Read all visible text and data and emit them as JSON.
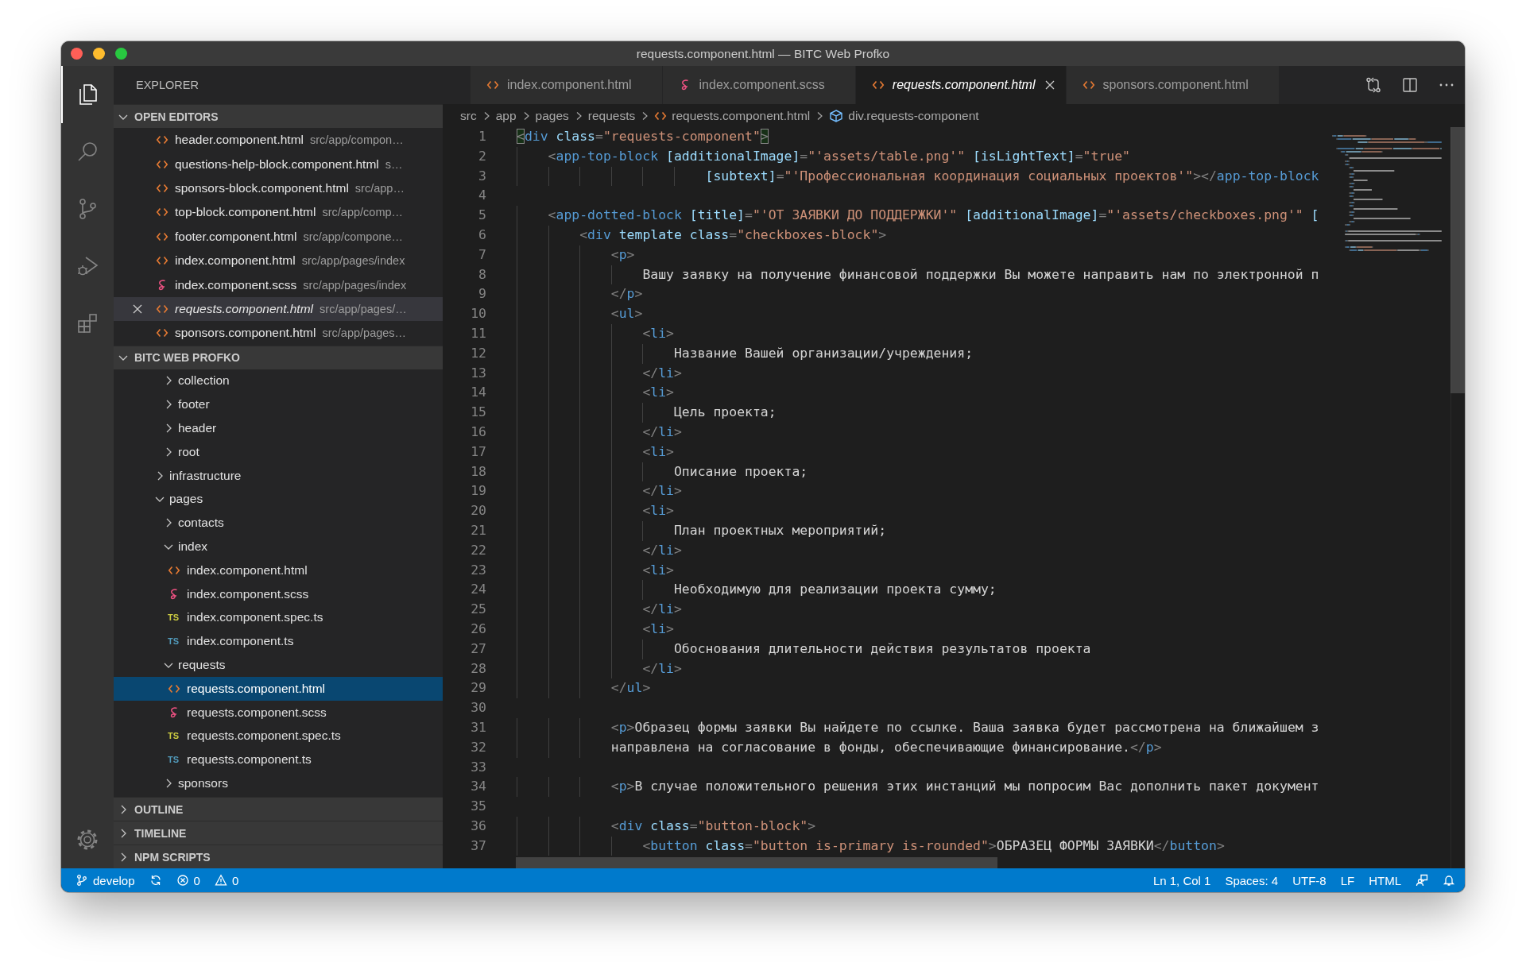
{
  "window": {
    "title": "requests.component.html — BITC Web Profko"
  },
  "activity_bar": {
    "items": [
      {
        "kind": "explorer",
        "selected": true
      },
      {
        "kind": "search",
        "selected": false
      },
      {
        "kind": "source-control",
        "selected": false
      },
      {
        "kind": "run-debug",
        "selected": false
      },
      {
        "kind": "extensions",
        "selected": false
      }
    ],
    "bottom": [
      {
        "kind": "settings"
      }
    ]
  },
  "sidebar": {
    "title": "EXPLORER",
    "sections": [
      {
        "kind": "open-editors",
        "title": "OPEN EDITORS",
        "expanded": true,
        "items": [
          {
            "kind": "html",
            "name": "header.component.html",
            "path": "src/app/compon…",
            "selected": false,
            "preview": false
          },
          {
            "kind": "html",
            "name": "questions-help-block.component.html",
            "path": "s…",
            "selected": false,
            "preview": false
          },
          {
            "kind": "html",
            "name": "sponsors-block.component.html",
            "path": "src/app…",
            "selected": false,
            "preview": false
          },
          {
            "kind": "html",
            "name": "top-block.component.html",
            "path": "src/app/comp…",
            "selected": false,
            "preview": false
          },
          {
            "kind": "html",
            "name": "footer.component.html",
            "path": "src/app/compone…",
            "selected": false,
            "preview": false
          },
          {
            "kind": "html",
            "name": "index.component.html",
            "path": "src/app/pages/index",
            "selected": false,
            "preview": false
          },
          {
            "kind": "scss",
            "name": "index.component.scss",
            "path": "src/app/pages/index",
            "selected": false,
            "preview": false
          },
          {
            "kind": "html",
            "name": "requests.component.html",
            "path": "src/app/pages/…",
            "selected": true,
            "preview": true
          },
          {
            "kind": "html",
            "name": "sponsors.component.html",
            "path": "src/app/pages…",
            "selected": false,
            "preview": false
          }
        ]
      },
      {
        "kind": "tree",
        "title": "BITC WEB PROFKO",
        "expanded": true,
        "tree": [
          {
            "children": [
              {
                "kind": "folder",
                "name": "collection",
                "expanded": false,
                "selected": false
              },
              {
                "kind": "folder",
                "name": "footer",
                "expanded": false,
                "selected": false
              },
              {
                "kind": "folder",
                "name": "header",
                "expanded": false,
                "selected": false
              },
              {
                "kind": "folder",
                "name": "root",
                "expanded": false,
                "selected": false
              }
            ]
          },
          {
            "kind": "folder",
            "name": "infrastructure",
            "expanded": false,
            "selected": false
          },
          {
            "kind": "folder",
            "name": "pages",
            "expanded": true,
            "selected": false,
            "children": [
              {
                "kind": "folder",
                "name": "contacts",
                "expanded": false,
                "selected": false
              },
              {
                "kind": "folder",
                "name": "index",
                "expanded": true,
                "selected": false,
                "children": [
                  {
                    "kind": "html",
                    "name": "index.component.html",
                    "selected": false
                  },
                  {
                    "kind": "scss",
                    "name": "index.component.scss",
                    "selected": false
                  },
                  {
                    "kind": "ts-spec",
                    "badge": "TS",
                    "name": "index.component.spec.ts",
                    "selected": false
                  },
                  {
                    "kind": "ts",
                    "badge": "TS",
                    "name": "index.component.ts",
                    "selected": false
                  }
                ]
              },
              {
                "kind": "folder",
                "name": "requests",
                "expanded": true,
                "selected": false,
                "children": [
                  {
                    "kind": "html",
                    "name": "requests.component.html",
                    "selected": true
                  },
                  {
                    "kind": "scss",
                    "name": "requests.component.scss",
                    "selected": false
                  },
                  {
                    "kind": "ts-spec",
                    "badge": "TS",
                    "name": "requests.component.spec.ts",
                    "selected": false
                  },
                  {
                    "kind": "ts",
                    "badge": "TS",
                    "name": "requests.component.ts",
                    "selected": false
                  }
                ]
              },
              {
                "kind": "folder",
                "name": "sponsors",
                "expanded": false,
                "selected": false
              }
            ]
          }
        ]
      },
      {
        "kind": "collapsed",
        "title": "OUTLINE",
        "expanded": false
      },
      {
        "kind": "collapsed",
        "title": "TIMELINE",
        "expanded": false
      },
      {
        "kind": "collapsed",
        "title": "NPM SCRIPTS",
        "expanded": false
      }
    ]
  },
  "tabs": [
    {
      "kind": "html",
      "label": "index.component.html",
      "selected": false,
      "preview": false
    },
    {
      "kind": "scss",
      "label": "index.component.scss",
      "selected": false,
      "preview": false
    },
    {
      "kind": "html",
      "label": "requests.component.html",
      "selected": true,
      "preview": true
    },
    {
      "kind": "html",
      "label": "sponsors.component.html",
      "selected": false,
      "preview": false
    }
  ],
  "editor_actions": [
    {
      "kind": "compare"
    },
    {
      "kind": "split"
    },
    {
      "kind": "more"
    }
  ],
  "breadcrumbs": [
    {
      "kind": "folder",
      "text": "src"
    },
    {
      "kind": "folder",
      "text": "app"
    },
    {
      "kind": "folder",
      "text": "pages"
    },
    {
      "kind": "folder",
      "text": "requests"
    },
    {
      "kind": "html",
      "text": "requests.component.html"
    },
    {
      "kind": "symbol",
      "text": "div.requests-component"
    }
  ],
  "editor": {
    "lines": [
      {
        "number": "1",
        "tokens": [
          {
            "kind": "match",
            "text": "<"
          },
          {
            "kind": "tag",
            "text": "div"
          },
          {
            "kind": "attr",
            "text": " class"
          },
          {
            "kind": "punct",
            "text": "="
          },
          {
            "kind": "string",
            "text": "\"requests-component\""
          },
          {
            "kind": "match",
            "text": ">"
          }
        ]
      },
      {
        "number": "2",
        "tokens": [
          {
            "kind": "punct",
            "text": "    <"
          },
          {
            "kind": "tag",
            "text": "app-top-block"
          },
          {
            "kind": "attr",
            "text": " [additionalImage]"
          },
          {
            "kind": "punct",
            "text": "="
          },
          {
            "kind": "string",
            "text": "\"'assets/table.png'\""
          },
          {
            "kind": "attr",
            "text": " [isLightText]"
          },
          {
            "kind": "punct",
            "text": "="
          },
          {
            "kind": "string",
            "text": "\"true\""
          }
        ]
      },
      {
        "number": "3",
        "tokens": [
          {
            "kind": "attr",
            "text": "                        [subtext]"
          },
          {
            "kind": "punct",
            "text": "="
          },
          {
            "kind": "string",
            "text": "\"'Профессиональная координация социальных проектов'\""
          },
          {
            "kind": "punct",
            "text": "></"
          },
          {
            "kind": "tag",
            "text": "app-top-block"
          }
        ]
      },
      {
        "number": "4"
      },
      {
        "number": "5",
        "tokens": [
          {
            "kind": "punct",
            "text": "    <"
          },
          {
            "kind": "tag",
            "text": "app-dotted-block"
          },
          {
            "kind": "attr",
            "text": " [title]"
          },
          {
            "kind": "punct",
            "text": "="
          },
          {
            "kind": "string",
            "text": "\"'ОТ ЗАЯВКИ ДО ПОДДЕРЖКИ'\""
          },
          {
            "kind": "attr",
            "text": " [additionalImage]"
          },
          {
            "kind": "punct",
            "text": "="
          },
          {
            "kind": "string",
            "text": "\"'assets/checkboxes.png'\""
          },
          {
            "kind": "attr",
            "text": " ["
          }
        ]
      },
      {
        "number": "6",
        "tokens": [
          {
            "kind": "punct",
            "text": "        <"
          },
          {
            "kind": "tag",
            "text": "div"
          },
          {
            "kind": "attr",
            "text": " template class"
          },
          {
            "kind": "punct",
            "text": "="
          },
          {
            "kind": "string",
            "text": "\"checkboxes-block\""
          },
          {
            "kind": "punct",
            "text": ">"
          }
        ]
      },
      {
        "number": "7",
        "tokens": [
          {
            "kind": "punct",
            "text": "            <"
          },
          {
            "kind": "tag",
            "text": "p"
          },
          {
            "kind": "punct",
            "text": ">"
          }
        ]
      },
      {
        "number": "8",
        "tokens": [
          {
            "kind": "text",
            "text": "                Вашу заявку на получение финансовой поддержки Вы можете направить нам по электронной п"
          }
        ]
      },
      {
        "number": "9",
        "tokens": [
          {
            "kind": "punct",
            "text": "            </"
          },
          {
            "kind": "tag",
            "text": "p"
          },
          {
            "kind": "punct",
            "text": ">"
          }
        ]
      },
      {
        "number": "10",
        "tokens": [
          {
            "kind": "punct",
            "text": "            <"
          },
          {
            "kind": "tag",
            "text": "ul"
          },
          {
            "kind": "punct",
            "text": ">"
          }
        ]
      },
      {
        "number": "11",
        "tokens": [
          {
            "kind": "punct",
            "text": "                <"
          },
          {
            "kind": "tag",
            "text": "li"
          },
          {
            "kind": "punct",
            "text": ">"
          }
        ]
      },
      {
        "number": "12",
        "tokens": [
          {
            "kind": "text",
            "text": "                    Название Вашей организации/учреждения;"
          }
        ]
      },
      {
        "number": "13",
        "tokens": [
          {
            "kind": "punct",
            "text": "                </"
          },
          {
            "kind": "tag",
            "text": "li"
          },
          {
            "kind": "punct",
            "text": ">"
          }
        ]
      },
      {
        "number": "14",
        "tokens": [
          {
            "kind": "punct",
            "text": "                <"
          },
          {
            "kind": "tag",
            "text": "li"
          },
          {
            "kind": "punct",
            "text": ">"
          }
        ]
      },
      {
        "number": "15",
        "tokens": [
          {
            "kind": "text",
            "text": "                    Цель проекта;"
          }
        ]
      },
      {
        "number": "16",
        "tokens": [
          {
            "kind": "punct",
            "text": "                </"
          },
          {
            "kind": "tag",
            "text": "li"
          },
          {
            "kind": "punct",
            "text": ">"
          }
        ]
      },
      {
        "number": "17",
        "tokens": [
          {
            "kind": "punct",
            "text": "                <"
          },
          {
            "kind": "tag",
            "text": "li"
          },
          {
            "kind": "punct",
            "text": ">"
          }
        ]
      },
      {
        "number": "18",
        "tokens": [
          {
            "kind": "text",
            "text": "                    Описание проекта;"
          }
        ]
      },
      {
        "number": "19",
        "tokens": [
          {
            "kind": "punct",
            "text": "                </"
          },
          {
            "kind": "tag",
            "text": "li"
          },
          {
            "kind": "punct",
            "text": ">"
          }
        ]
      },
      {
        "number": "20",
        "tokens": [
          {
            "kind": "punct",
            "text": "                <"
          },
          {
            "kind": "tag",
            "text": "li"
          },
          {
            "kind": "punct",
            "text": ">"
          }
        ]
      },
      {
        "number": "21",
        "tokens": [
          {
            "kind": "text",
            "text": "                    План проектных мероприятий;"
          }
        ]
      },
      {
        "number": "22",
        "tokens": [
          {
            "kind": "punct",
            "text": "                </"
          },
          {
            "kind": "tag",
            "text": "li"
          },
          {
            "kind": "punct",
            "text": ">"
          }
        ]
      },
      {
        "number": "23",
        "tokens": [
          {
            "kind": "punct",
            "text": "                <"
          },
          {
            "kind": "tag",
            "text": "li"
          },
          {
            "kind": "punct",
            "text": ">"
          }
        ]
      },
      {
        "number": "24",
        "tokens": [
          {
            "kind": "text",
            "text": "                    Необходимую для реализации проекта сумму;"
          }
        ]
      },
      {
        "number": "25",
        "tokens": [
          {
            "kind": "punct",
            "text": "                </"
          },
          {
            "kind": "tag",
            "text": "li"
          },
          {
            "kind": "punct",
            "text": ">"
          }
        ]
      },
      {
        "number": "26",
        "tokens": [
          {
            "kind": "punct",
            "text": "                <"
          },
          {
            "kind": "tag",
            "text": "li"
          },
          {
            "kind": "punct",
            "text": ">"
          }
        ]
      },
      {
        "number": "27",
        "tokens": [
          {
            "kind": "text",
            "text": "                    Обоснования длительности действия результатов проекта"
          }
        ]
      },
      {
        "number": "28",
        "tokens": [
          {
            "kind": "punct",
            "text": "                </"
          },
          {
            "kind": "tag",
            "text": "li"
          },
          {
            "kind": "punct",
            "text": ">"
          }
        ]
      },
      {
        "number": "29",
        "tokens": [
          {
            "kind": "punct",
            "text": "            </"
          },
          {
            "kind": "tag",
            "text": "ul"
          },
          {
            "kind": "punct",
            "text": ">"
          }
        ]
      },
      {
        "number": "30"
      },
      {
        "number": "31",
        "tokens": [
          {
            "kind": "punct",
            "text": "            <"
          },
          {
            "kind": "tag",
            "text": "p"
          },
          {
            "kind": "punct",
            "text": ">"
          },
          {
            "kind": "text",
            "text": "Образец формы заявки Вы найдете по ссылке. Ваша заявка будет рассмотрена на ближайшем з"
          }
        ]
      },
      {
        "number": "32",
        "tokens": [
          {
            "kind": "text",
            "text": "            направлена на согласование в фонды, обеспечивающие финансирование."
          },
          {
            "kind": "punct",
            "text": "</"
          },
          {
            "kind": "tag",
            "text": "p"
          },
          {
            "kind": "punct",
            "text": ">"
          }
        ]
      },
      {
        "number": "33"
      },
      {
        "number": "34",
        "tokens": [
          {
            "kind": "punct",
            "text": "            <"
          },
          {
            "kind": "tag",
            "text": "p"
          },
          {
            "kind": "punct",
            "text": ">"
          },
          {
            "kind": "text",
            "text": "В случае положительного решения этих инстанций мы попросим Вас дополнить пакет документ"
          }
        ]
      },
      {
        "number": "35"
      },
      {
        "number": "36",
        "tokens": [
          {
            "kind": "punct",
            "text": "            <"
          },
          {
            "kind": "tag",
            "text": "div"
          },
          {
            "kind": "attr",
            "text": " class"
          },
          {
            "kind": "punct",
            "text": "="
          },
          {
            "kind": "string",
            "text": "\"button-block\""
          },
          {
            "kind": "punct",
            "text": ">"
          }
        ]
      },
      {
        "number": "37",
        "tokens": [
          {
            "kind": "punct",
            "text": "                <"
          },
          {
            "kind": "tag",
            "text": "button"
          },
          {
            "kind": "attr",
            "text": " class"
          },
          {
            "kind": "punct",
            "text": "="
          },
          {
            "kind": "string",
            "text": "\"button is-primary is-rounded\""
          },
          {
            "kind": "punct",
            "text": ">"
          },
          {
            "kind": "text",
            "text": "ОБРАЗЕЦ ФОРМЫ ЗАЯВКИ"
          },
          {
            "kind": "punct",
            "text": "</"
          },
          {
            "kind": "tag",
            "text": "button"
          },
          {
            "kind": "punct",
            "text": ">"
          }
        ]
      }
    ]
  },
  "status_bar": {
    "left": [
      {
        "kind": "branch",
        "text": "develop"
      },
      {
        "kind": "sync"
      },
      {
        "kind": "errors",
        "text": "0"
      },
      {
        "kind": "warnings",
        "text": "0"
      }
    ],
    "right": [
      {
        "kind": "text",
        "text": "Ln 1, Col 1"
      },
      {
        "kind": "text",
        "text": "Spaces: 4"
      },
      {
        "kind": "text",
        "text": "UTF-8"
      },
      {
        "kind": "text",
        "text": "LF"
      },
      {
        "kind": "text",
        "text": "HTML"
      },
      {
        "kind": "feedback"
      },
      {
        "kind": "notifications"
      }
    ]
  }
}
